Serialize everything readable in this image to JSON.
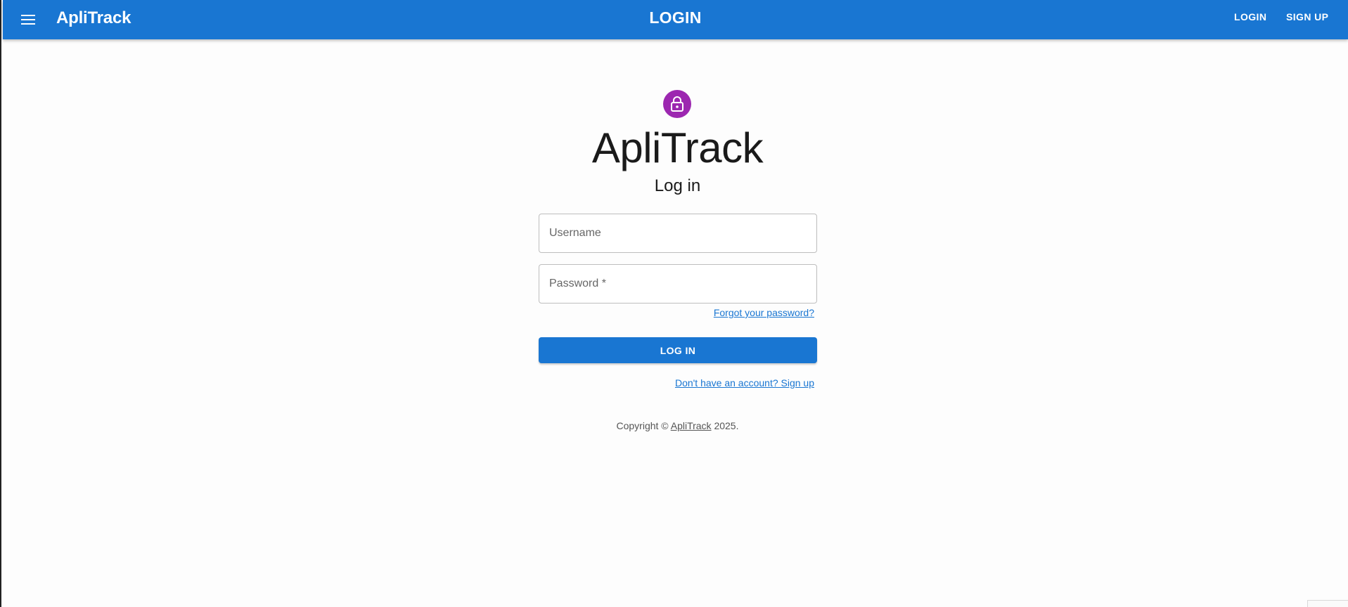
{
  "appbar": {
    "brand": "ApliTrack",
    "title": "LOGIN",
    "nav": {
      "login_label": "LOGIN",
      "signup_label": "SIGN UP"
    },
    "menu_icon": "menu-icon"
  },
  "form": {
    "lock_icon": "lock-icon",
    "app_title": "ApliTrack",
    "subtitle": "Log in",
    "username": {
      "value": "",
      "placeholder": "Username"
    },
    "password": {
      "value": "",
      "placeholder": "Password *"
    },
    "forgot_link": "Forgot your password?",
    "submit_label": "LOG IN",
    "signup_link": "Don't have an account? Sign up"
  },
  "footer": {
    "copyright_prefix": "Copyright © ",
    "copyright_brand": "ApliTrack",
    "copyright_suffix": " 2025."
  },
  "colors": {
    "primary": "#1976d2",
    "avatar": "#9c27b0"
  }
}
